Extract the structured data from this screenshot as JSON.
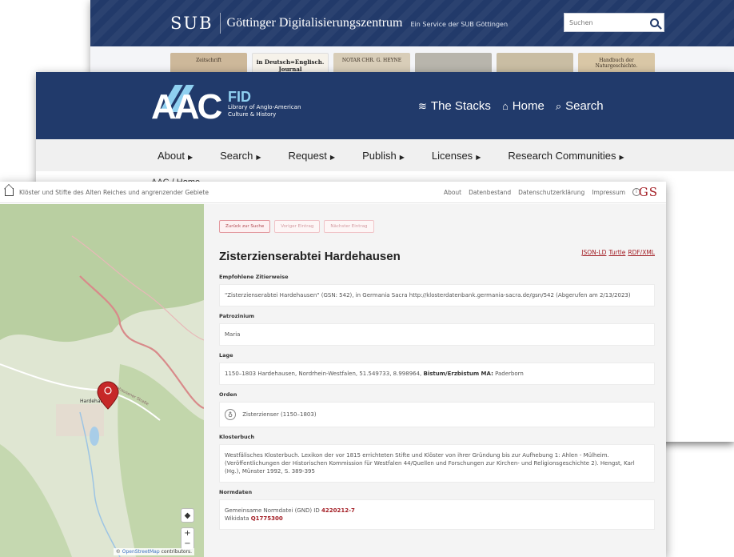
{
  "sub": {
    "logo": "SUB",
    "title": "Göttinger Digitalisierungszentrum",
    "service": "Ein Service der SUB Göttingen",
    "search_placeholder": "Suchen",
    "books": [
      "Zeitschrift",
      "in Deutsch=Englisch. Journal",
      "NOTAR CHR. G. HEYNE",
      "",
      "",
      "Handbuch der Naturgeschichte."
    ]
  },
  "aac": {
    "logo_letters": "AAC",
    "logo_fid": "FID",
    "logo_sub1": "Library of Anglo-American",
    "logo_sub2": "Culture & History",
    "nav": [
      {
        "icon": "≋",
        "label": "The Stacks"
      },
      {
        "icon": "⌂",
        "label": "Home"
      },
      {
        "icon": "⌕",
        "label": "Search"
      }
    ],
    "menu": [
      "About",
      "Search",
      "Request",
      "Publish",
      "Licenses",
      "Research Communities"
    ],
    "breadcrumb": "AAC / Home"
  },
  "gs": {
    "site_title": "Klöster und Stifte des Alten Reiches und angrenzender Gebiete",
    "links": [
      "About",
      "Datenbestand",
      "Datenschutzerklärung",
      "Impressum"
    ],
    "logo": "GS",
    "buttons": [
      "Zurück zur Suche",
      "Voriger Eintrag",
      "Nächster Eintrag"
    ],
    "title": "Zisterzienserabtei Hardehausen",
    "formats": [
      "JSON-LD",
      "Turtle",
      "RDF/XML"
    ],
    "sections": {
      "citation_label": "Empfohlene Zitierweise",
      "citation": "\"Zisterzienserabtei Hardehausen\" (GSN: 542), in Germania Sacra http://klosterdatenbank.germania-sacra.de/gsn/542 (Abgerufen am 2/13/2023)",
      "patrozinium_label": "Patrozinium",
      "patrozinium": "Maria",
      "lage_label": "Lage",
      "lage": "1150–1803 Hardehausen, Nordrhein-Westfalen, 51.549733, 8.998964,",
      "lage_bistum_label": "Bistum/Erzbistum MA:",
      "lage_bistum": "Paderborn",
      "orden_label": "Orden",
      "orden": "Zisterzienser (1150–1803)",
      "klosterbuch_label": "Klosterbuch",
      "klosterbuch": "Westfälisches Klosterbuch. Lexikon der vor 1815 errichteten Stifte und Klöster von ihrer Gründung bis zur Aufhebung 1: Ahlen - Mülheim. (Veröffentlichungen der Historischen Kommission für Westfalen 44/Quellen und Forschungen zur Kirchen- und Religionsgeschichte 2). Hengst, Karl (Hg.), Münster 1992, S. 389-395",
      "normdaten_label": "Normdaten",
      "gnd_label": "Gemeinsame Normdatei (GND) ID",
      "gnd": "4220212-7",
      "wikidata_label": "Wikidata",
      "wikidata": "Q1775300"
    },
    "map": {
      "place_label": "Hardehausen",
      "road_label": "Hardehausener Straße",
      "zoom_in": "+",
      "zoom_out": "−",
      "attribution_prefix": "©",
      "attribution_link": "OpenStreetMap",
      "attribution_suffix": "contributors."
    }
  },
  "colors": {
    "sub_blue": "#223a6a",
    "aac_blue": "#213a6b",
    "aac_accent": "#8fd0f0",
    "gs_red": "#a31d24"
  }
}
